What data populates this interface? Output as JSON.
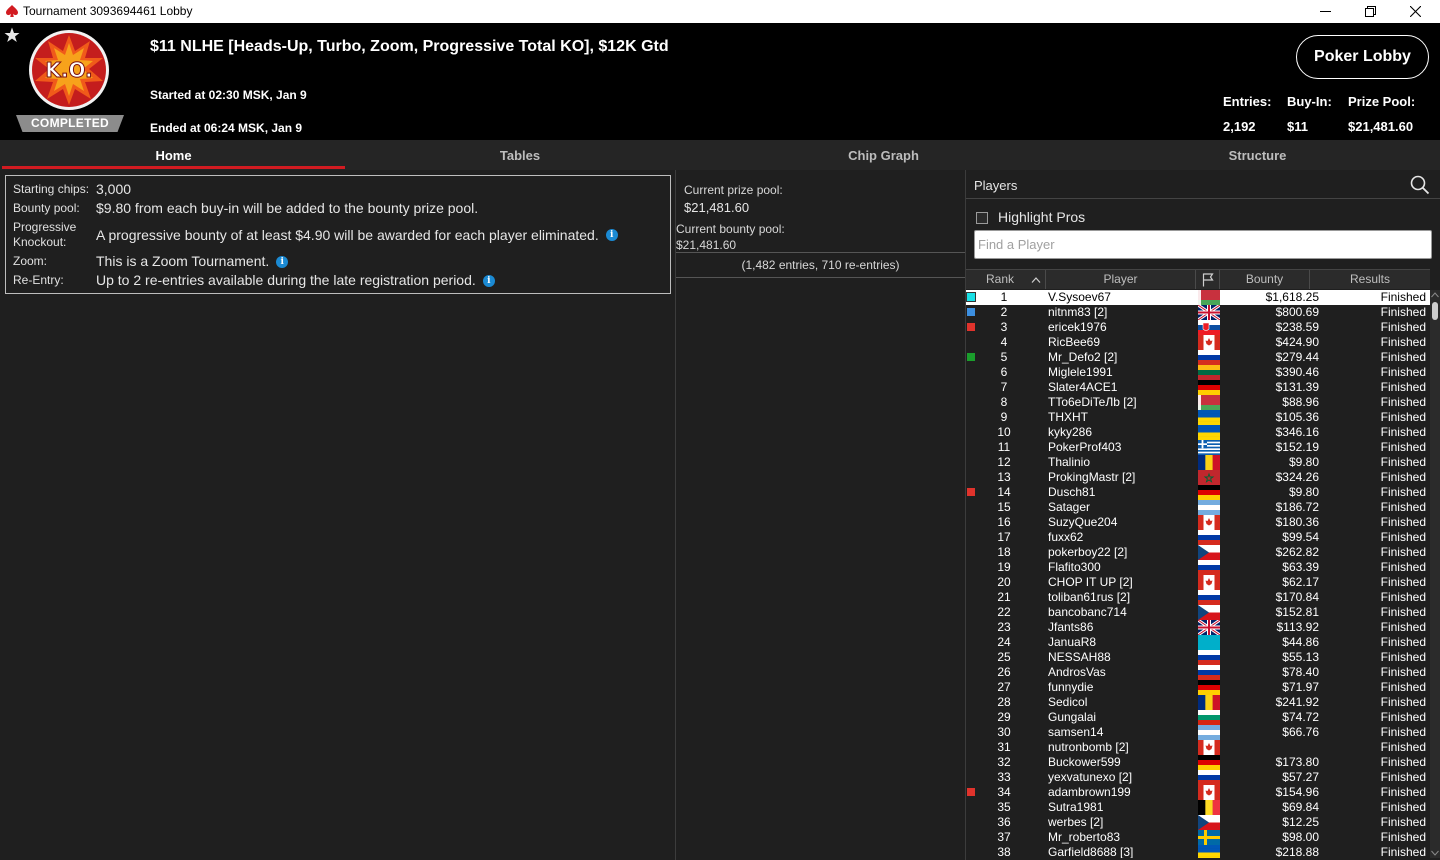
{
  "window": {
    "title": "Tournament 3093694461 Lobby",
    "controls": [
      "minimize",
      "restore",
      "close"
    ]
  },
  "header": {
    "badge": "COMPLETED",
    "logo_text": "K.O.",
    "title": "$11 NLHE [Heads-Up, Turbo, Zoom, Progressive Total KO], $12K Gtd",
    "started": "Started at 02:30 MSK, Jan 9",
    "ended": "Ended at 06:24 MSK, Jan 9",
    "lobby_button": "Poker Lobby",
    "stats": [
      {
        "label": "Entries:",
        "value": "2,192"
      },
      {
        "label": "Buy-In:",
        "value": "$11"
      },
      {
        "label": "Prize Pool:",
        "value": "$21,481.60"
      }
    ]
  },
  "tabs": [
    {
      "label": "Home",
      "active": true
    },
    {
      "label": "Tables",
      "active": false
    },
    {
      "label": "Chip Graph",
      "active": false
    },
    {
      "label": "Structure",
      "active": false
    }
  ],
  "info": {
    "starting_chips_label": "Starting chips:",
    "starting_chips": "3,000",
    "bounty_pool_label": "Bounty pool:",
    "bounty_pool": "$9.80 from each buy-in will be added to the bounty prize pool.",
    "pko_label_1": "Progressive",
    "pko_label_2": "Knockout:",
    "pko": "A progressive bounty of at least $4.90 will be awarded for each player eliminated.",
    "zoom_label": "Zoom:",
    "zoom": "This is a Zoom Tournament.",
    "reentry_label": "Re-Entry:",
    "reentry": "Up to 2 re-entries available during the late registration period."
  },
  "pool": {
    "prize_label": "Current prize pool:",
    "prize_value": "$21,481.60",
    "bounty_label": "Current bounty pool:",
    "bounty_value": "$21,481.60",
    "entries_note": "(1,482 entries, 710 re-entries)"
  },
  "players": {
    "title": "Players",
    "highlight_label": "Highlight Pros",
    "search_placeholder": "Find a Player",
    "columns": {
      "rank": "Rank",
      "player": "Player",
      "bounty": "Bounty",
      "results": "Results"
    },
    "rows": [
      {
        "rank": "1",
        "name": "V.Sysoev67",
        "flag": "by",
        "bounty": "$1,618.25",
        "result": "Finished",
        "marker": "#19e0e6",
        "selected": true
      },
      {
        "rank": "2",
        "name": "nitnm83 [2]",
        "flag": "gb",
        "bounty": "$800.69",
        "result": "Finished",
        "marker": "#3c8fe0"
      },
      {
        "rank": "3",
        "name": "ericek1976",
        "flag": "sk",
        "bounty": "$238.59",
        "result": "Finished",
        "marker": "#e0332c"
      },
      {
        "rank": "4",
        "name": "RicBee69",
        "flag": "ca",
        "bounty": "$424.90",
        "result": "Finished"
      },
      {
        "rank": "5",
        "name": "Mr_Defo2 [2]",
        "flag": "ru",
        "bounty": "$279.44",
        "result": "Finished",
        "marker": "#1a9e2c"
      },
      {
        "rank": "6",
        "name": "Miglele1991",
        "flag": "lt",
        "bounty": "$390.46",
        "result": "Finished"
      },
      {
        "rank": "7",
        "name": "Slater4ACE1",
        "flag": "de",
        "bounty": "$131.39",
        "result": "Finished"
      },
      {
        "rank": "8",
        "name": "TTo6eDiTeЛb [2]",
        "flag": "by",
        "bounty": "$88.96",
        "result": "Finished"
      },
      {
        "rank": "9",
        "name": "THXHT",
        "flag": "ua",
        "bounty": "$105.36",
        "result": "Finished"
      },
      {
        "rank": "10",
        "name": "kyky286",
        "flag": "ua",
        "bounty": "$346.16",
        "result": "Finished"
      },
      {
        "rank": "11",
        "name": "PokerProf403",
        "flag": "gr",
        "bounty": "$152.19",
        "result": "Finished"
      },
      {
        "rank": "12",
        "name": "Thalinio",
        "flag": "ro",
        "bounty": "$9.80",
        "result": "Finished"
      },
      {
        "rank": "13",
        "name": "ProkingMastr [2]",
        "flag": "ma",
        "bounty": "$324.26",
        "result": "Finished"
      },
      {
        "rank": "14",
        "name": "Dusch81",
        "flag": "de",
        "bounty": "$9.80",
        "result": "Finished",
        "marker": "#e0332c"
      },
      {
        "rank": "15",
        "name": "Satager",
        "flag": "ar",
        "bounty": "$186.72",
        "result": "Finished"
      },
      {
        "rank": "16",
        "name": "SuzyQue204",
        "flag": "ca",
        "bounty": "$180.36",
        "result": "Finished"
      },
      {
        "rank": "17",
        "name": "fuxx62",
        "flag": "ru",
        "bounty": "$99.54",
        "result": "Finished"
      },
      {
        "rank": "18",
        "name": "pokerboy22 [2]",
        "flag": "cz",
        "bounty": "$262.82",
        "result": "Finished"
      },
      {
        "rank": "19",
        "name": "Flafito300",
        "flag": "ru",
        "bounty": "$63.39",
        "result": "Finished"
      },
      {
        "rank": "20",
        "name": "CHOP IT UP [2]",
        "flag": "ca",
        "bounty": "$62.17",
        "result": "Finished"
      },
      {
        "rank": "21",
        "name": "toliban61rus [2]",
        "flag": "ru",
        "bounty": "$170.84",
        "result": "Finished"
      },
      {
        "rank": "22",
        "name": "bancobanc714",
        "flag": "cz",
        "bounty": "$152.81",
        "result": "Finished"
      },
      {
        "rank": "23",
        "name": "Jfants86",
        "flag": "gb",
        "bounty": "$113.92",
        "result": "Finished"
      },
      {
        "rank": "24",
        "name": "JanuaR8",
        "flag": "kz",
        "bounty": "$44.86",
        "result": "Finished"
      },
      {
        "rank": "25",
        "name": "NESSAH88",
        "flag": "ru",
        "bounty": "$55.13",
        "result": "Finished"
      },
      {
        "rank": "26",
        "name": "AndrosVas",
        "flag": "ru",
        "bounty": "$78.40",
        "result": "Finished"
      },
      {
        "rank": "27",
        "name": "funnydie",
        "flag": "de",
        "bounty": "$71.97",
        "result": "Finished"
      },
      {
        "rank": "28",
        "name": "Sedicol",
        "flag": "ro",
        "bounty": "$241.92",
        "result": "Finished"
      },
      {
        "rank": "29",
        "name": "Gungalai",
        "flag": "bg",
        "bounty": "$74.72",
        "result": "Finished"
      },
      {
        "rank": "30",
        "name": "samsen14",
        "flag": "ar",
        "bounty": "$66.76",
        "result": "Finished"
      },
      {
        "rank": "31",
        "name": "nutronbomb [2]",
        "flag": "ca",
        "bounty": "",
        "result": "Finished"
      },
      {
        "rank": "32",
        "name": "Buckower599",
        "flag": "de",
        "bounty": "$173.80",
        "result": "Finished"
      },
      {
        "rank": "33",
        "name": "yexvatunexo [2]",
        "flag": "ru",
        "bounty": "$57.27",
        "result": "Finished"
      },
      {
        "rank": "34",
        "name": "adambrown199",
        "flag": "ca",
        "bounty": "$154.96",
        "result": "Finished",
        "marker": "#e0332c"
      },
      {
        "rank": "35",
        "name": "Sutra1981",
        "flag": "be",
        "bounty": "$69.84",
        "result": "Finished"
      },
      {
        "rank": "36",
        "name": "werbes [2]",
        "flag": "cz",
        "bounty": "$12.25",
        "result": "Finished"
      },
      {
        "rank": "37",
        "name": "Mr_roberto83",
        "flag": "se",
        "bounty": "$98.00",
        "result": "Finished"
      },
      {
        "rank": "38",
        "name": "Garfield8688 [3]",
        "flag": "ua",
        "bounty": "$218.88",
        "result": "Finished"
      }
    ]
  },
  "colors": {
    "accent_red": "#d21b21",
    "header_bg": "#000000",
    "panel_bg": "#1f1f1f",
    "info_icon": "#1b8ad3"
  }
}
